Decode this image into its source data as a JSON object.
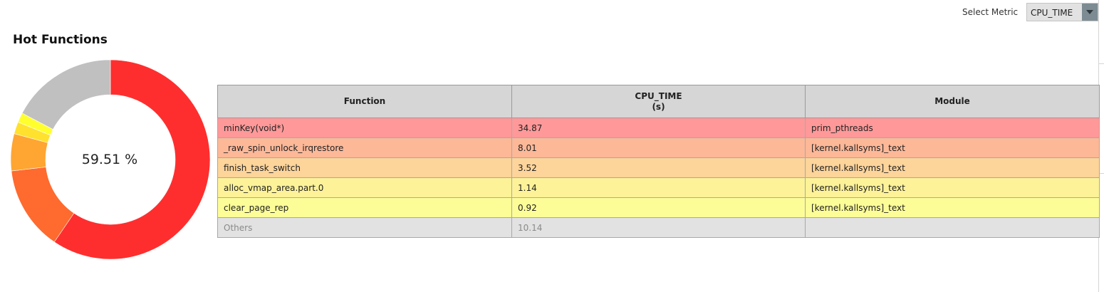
{
  "metric": {
    "label": "Select Metric",
    "selected": "CPU_TIME"
  },
  "panel": {
    "title": "Hot Functions"
  },
  "donut": {
    "center_label": "59.51 %",
    "segments": [
      {
        "name": "minKey(void*)",
        "value": 34.87,
        "color": "#ff2e2e"
      },
      {
        "name": "_raw_spin_unlock_irqrestore",
        "value": 8.01,
        "color": "#ff6a2e"
      },
      {
        "name": "finish_task_switch",
        "value": 3.52,
        "color": "#ffa531"
      },
      {
        "name": "alloc_vmap_area.part.0",
        "value": 1.14,
        "color": "#ffe12e"
      },
      {
        "name": "clear_page_rep",
        "value": 0.92,
        "color": "#ffff2e"
      },
      {
        "name": "Others",
        "value": 10.14,
        "color": "#c0c0c0"
      }
    ]
  },
  "table": {
    "headers": {
      "function": "Function",
      "metric": "CPU_TIME",
      "unit": "(s)",
      "module": "Module"
    },
    "rows": [
      {
        "function": "minKey(void*)",
        "value": "34.87",
        "module": "prim_pthreads",
        "bg": "#ff9999"
      },
      {
        "function": "_raw_spin_unlock_irqrestore",
        "value": "8.01",
        "module": "[kernel.kallsyms]_text",
        "bg": "#fdb898"
      },
      {
        "function": "finish_task_switch",
        "value": "3.52",
        "module": "[kernel.kallsyms]_text",
        "bg": "#fdd49a"
      },
      {
        "function": "alloc_vmap_area.part.0",
        "value": "1.14",
        "module": "[kernel.kallsyms]_text",
        "bg": "#fdf298"
      },
      {
        "function": "clear_page_rep",
        "value": "0.92",
        "module": "[kernel.kallsyms]_text",
        "bg": "#fdfd98"
      },
      {
        "function": "Others",
        "value": "10.14",
        "module": "",
        "bg": "#e2e2e2"
      }
    ]
  }
}
